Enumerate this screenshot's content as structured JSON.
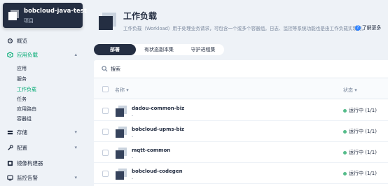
{
  "project": {
    "name": "bobcloud-java-test",
    "type": "项目"
  },
  "sidebar": {
    "items": [
      {
        "label": "概览"
      },
      {
        "label": "应用负载",
        "expanded": true
      },
      {
        "label": "存储"
      },
      {
        "label": "配置"
      },
      {
        "label": "镜像构建器"
      },
      {
        "label": "监控告警"
      }
    ],
    "subitems": [
      "应用",
      "服务",
      "工作负载",
      "任务",
      "应用路由",
      "容器组"
    ]
  },
  "page": {
    "title": "工作负载",
    "description": "工作负载（Workload）用于处理业务请求，可包含一个或多个容器组。日志、监控等系统功能也是由工作负载实现的。",
    "learn_more": "了解更多"
  },
  "tabs": [
    "部署",
    "有状态副本集",
    "守护进程集"
  ],
  "search": {
    "placeholder": "搜索"
  },
  "table": {
    "columns": {
      "name": "名称",
      "status": "状态"
    },
    "rows": [
      {
        "name": "dadou-common-biz",
        "sub": "-",
        "status": "运行中 (1/1)"
      },
      {
        "name": "bobcloud-upms-biz",
        "sub": "-",
        "status": "运行中 (1/1)"
      },
      {
        "name": "mqtt-common",
        "sub": "-",
        "status": "运行中 (1/1)"
      },
      {
        "name": "bobcloud-codegen",
        "sub": "-",
        "status": "运行中 (1/1)"
      }
    ]
  },
  "colors": {
    "accent": "#00aa72",
    "dark": "#242e42",
    "running": "#55bc8a"
  }
}
